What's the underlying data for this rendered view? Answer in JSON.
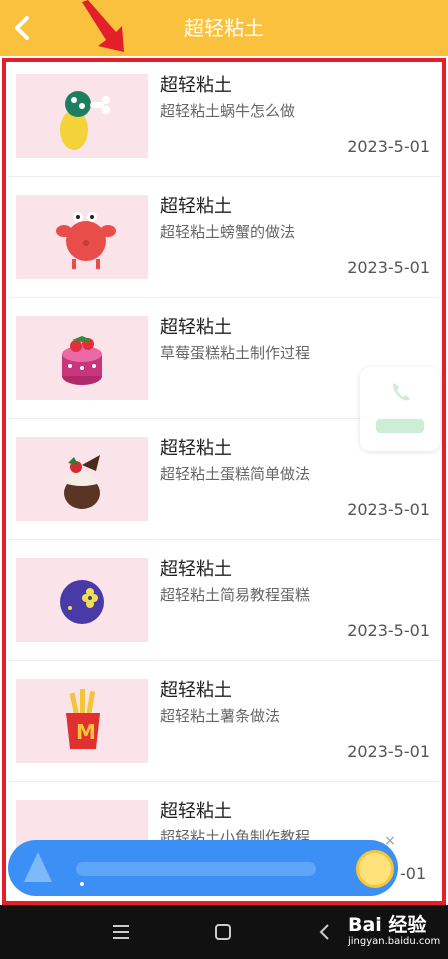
{
  "header": {
    "title": "超轻粘土",
    "back_icon": "chevron-left-icon",
    "bg_color": "#f9c13e"
  },
  "annotation": {
    "arrow_color": "#e3202a",
    "frame_color": "#e3202a"
  },
  "items": [
    {
      "title": "超轻粘土",
      "subtitle": "超轻粘土蜗牛怎么做",
      "date": "2023-5-01",
      "thumb": "snail"
    },
    {
      "title": "超轻粘土",
      "subtitle": "超轻粘土螃蟹的做法",
      "date": "2023-5-01",
      "thumb": "crab"
    },
    {
      "title": "超轻粘土",
      "subtitle": "草莓蛋糕粘土制作过程",
      "date": "2023-5-01",
      "thumb": "strawberry-cake"
    },
    {
      "title": "超轻粘土",
      "subtitle": "超轻粘土蛋糕简单做法",
      "date": "2023-5-01",
      "thumb": "chocolate-cake"
    },
    {
      "title": "超轻粘土",
      "subtitle": "超轻粘土简易教程蛋糕",
      "date": "2023-5-01",
      "thumb": "purple-ball"
    },
    {
      "title": "超轻粘土",
      "subtitle": "超轻粘土薯条做法",
      "date": "2023-5-01",
      "thumb": "fries"
    },
    {
      "title": "超轻粘土",
      "subtitle": "超轻粘土小鱼制作教程",
      "date": "2023-5-01",
      "thumb": "fish"
    }
  ],
  "float_button": {
    "icon": "phone-icon"
  },
  "banner": {
    "close_label": "×"
  },
  "navbar": {
    "menu_icon": "menu-icon",
    "home_icon": "home-icon",
    "back_icon": "back-icon"
  },
  "watermark": {
    "brand": "Bai 经验",
    "url": "jingyan.baidu.com"
  }
}
